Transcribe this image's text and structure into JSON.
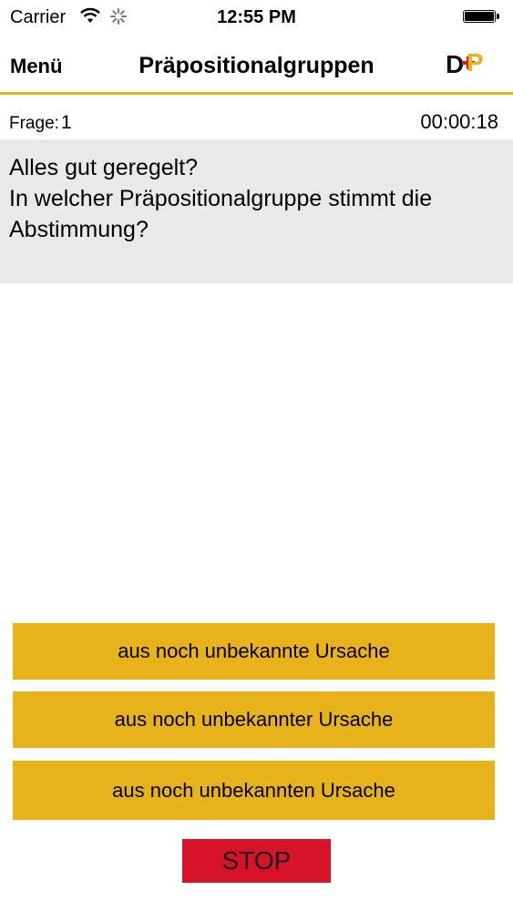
{
  "status_bar": {
    "carrier": "Carrier",
    "time": "12:55 PM",
    "icons": [
      "wifi-icon",
      "activity-spinner-icon",
      "battery-icon"
    ]
  },
  "nav": {
    "menu_label": "Menü",
    "title": "Präpositionalgruppen",
    "logo_letters": "DP"
  },
  "info": {
    "frage_label": "Frage:",
    "frage_number": "1",
    "timer": "00:00:18"
  },
  "question": {
    "line1": "Alles gut geregelt?",
    "line2": "In welcher Präpositionalgruppe stimmt die",
    "line3": "Abstimmung?"
  },
  "answers": [
    "aus noch unbekannte Ursache",
    "aus noch unbekannter Ursache",
    "aus noch unbekannten Ursache"
  ],
  "stop_label": "STOP",
  "colors": {
    "accent": "#E8B21A",
    "stop": "#D7132A",
    "question_bg": "#E9E9E9"
  }
}
